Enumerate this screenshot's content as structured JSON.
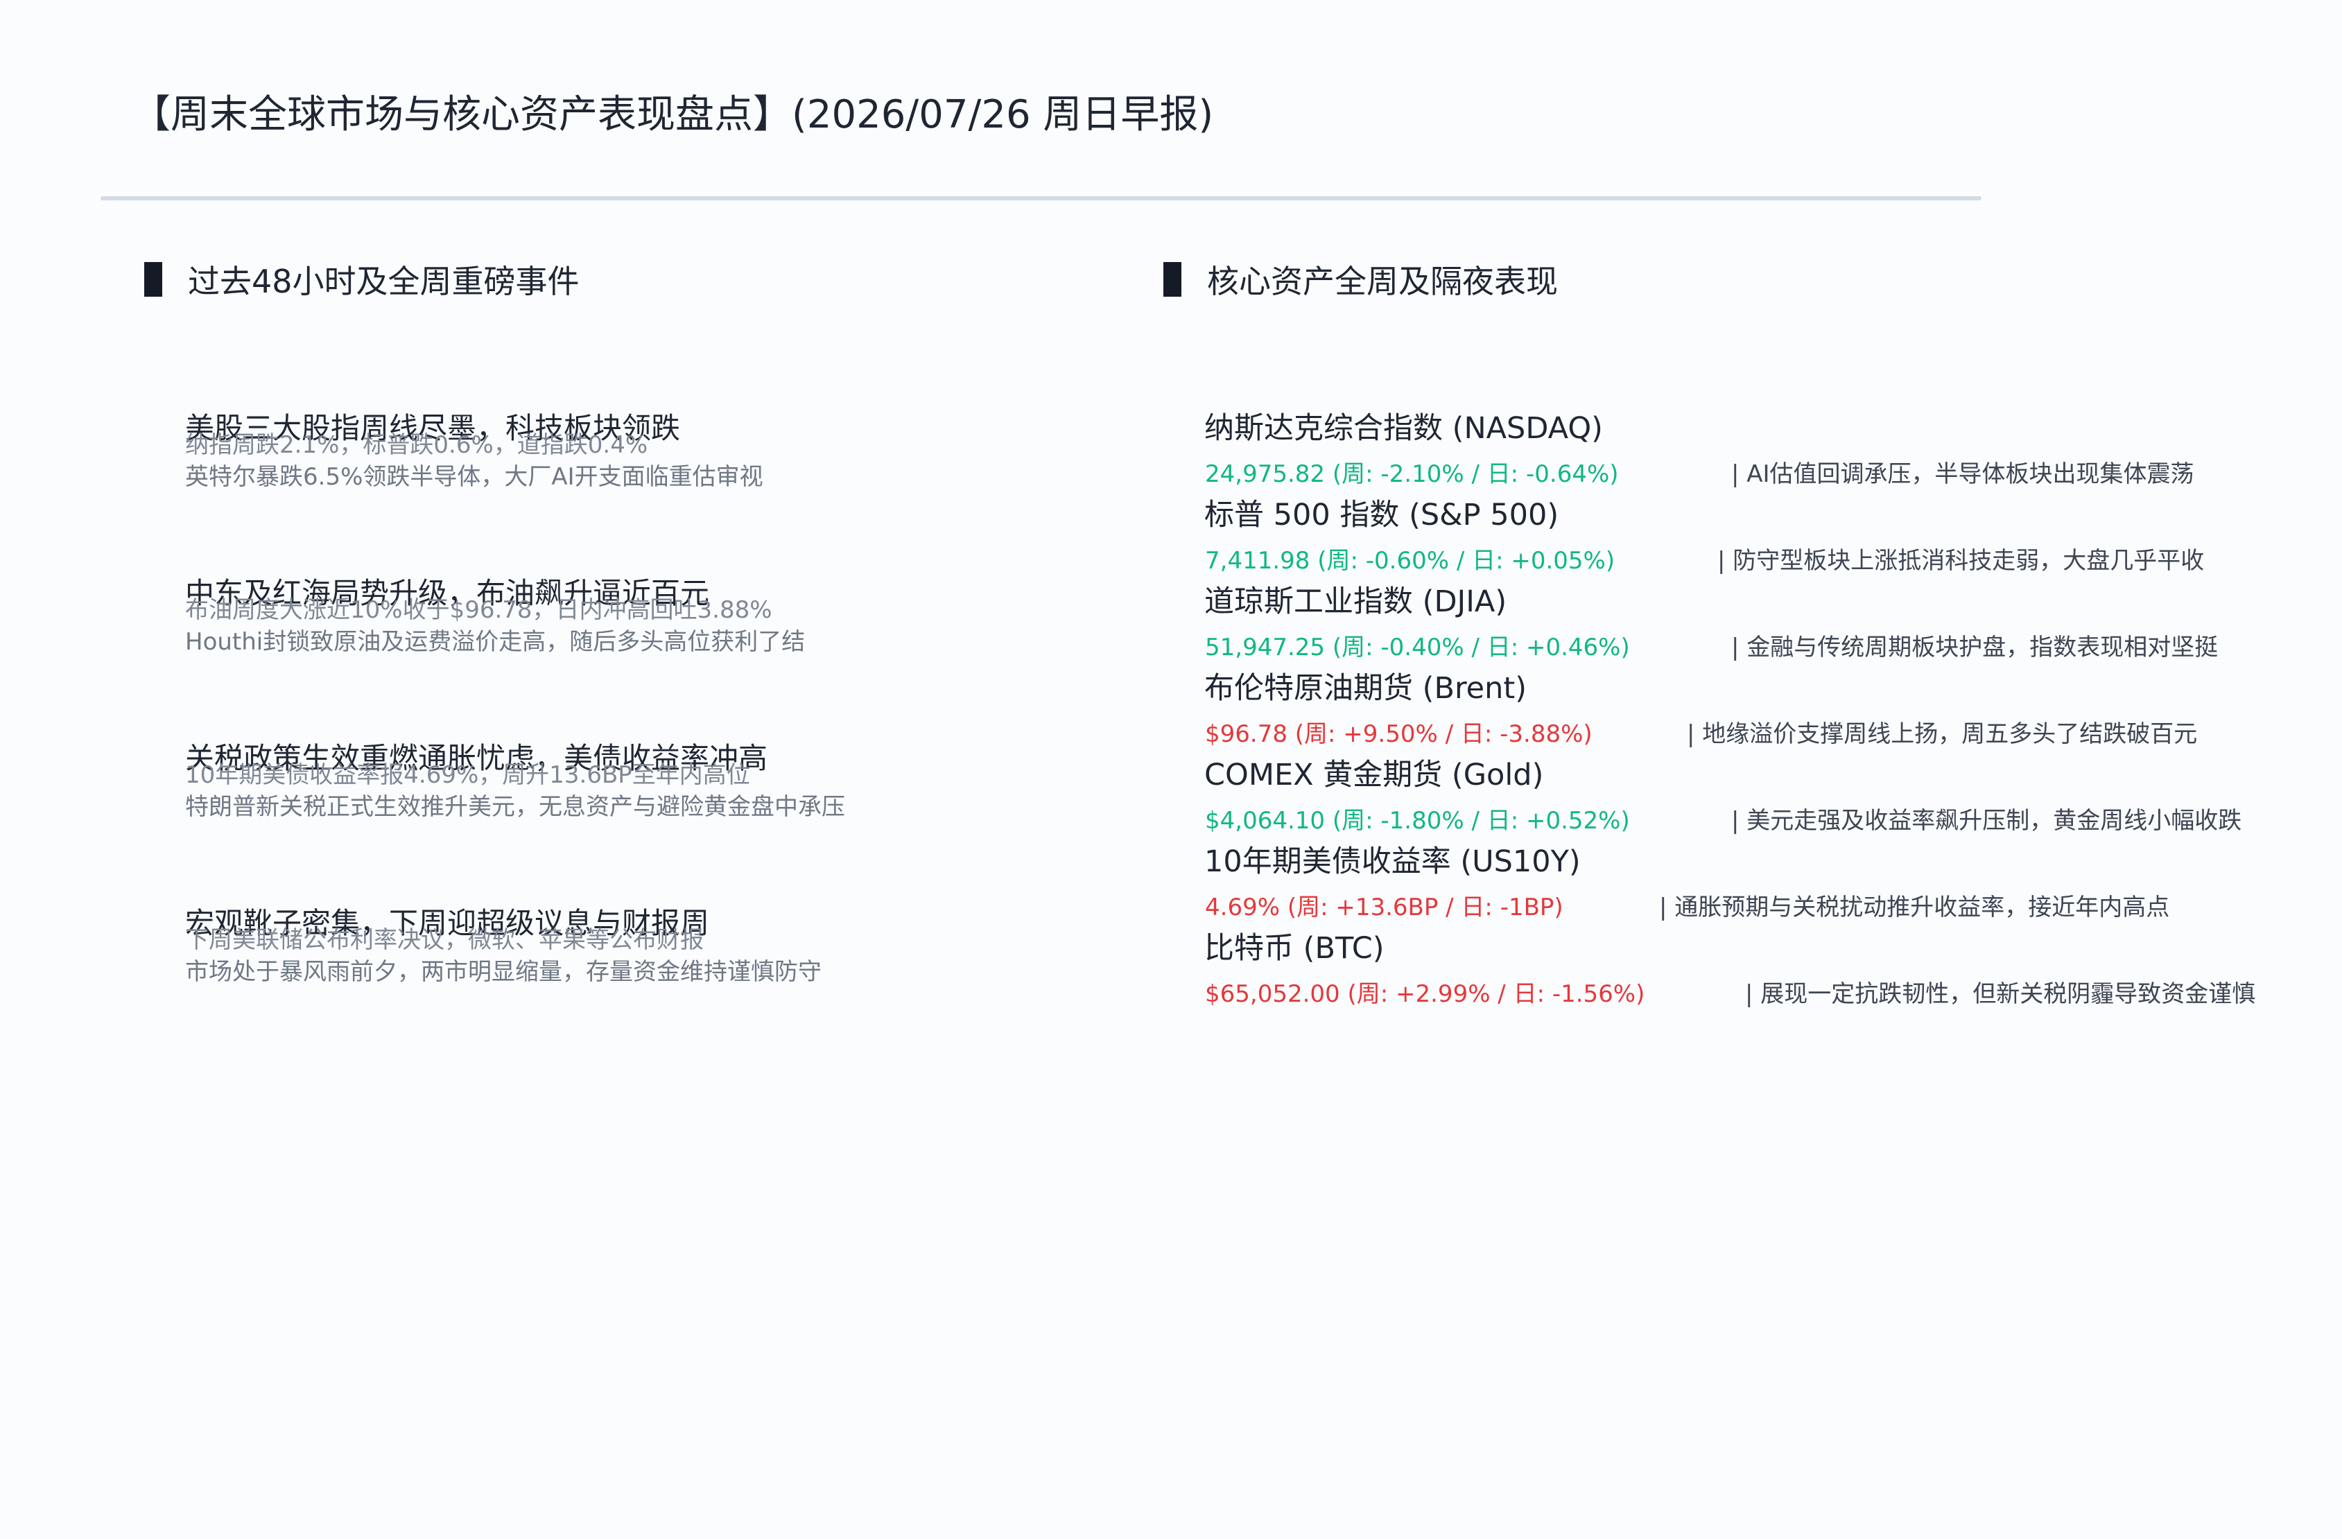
{
  "header": {
    "title": "【周末全球市场与核心资产表现盘点】(2026/07/26 周日早报)"
  },
  "sections": {
    "events_heading": "过去48小时及全周重磅事件",
    "assets_heading": "核心资产全周及隔夜表现"
  },
  "events": [
    {
      "title": "美股三大股指周线尽墨，科技板块领跌",
      "line1": "纳指周跌2.1%，标普跌0.6%，道指跌0.4%",
      "line2": "英特尔暴跌6.5%领跌半导体，大厂AI开支面临重估审视"
    },
    {
      "title": "中东及红海局势升级，布油飙升逼近百元",
      "line1": "布油周度大涨近10%收于$96.78，日内冲高回吐3.88%",
      "line2": "Houthi封锁致原油及运费溢价走高，随后多头高位获利了结"
    },
    {
      "title": "关税政策生效重燃通胀忧虑，美债收益率冲高",
      "line1": "10年期美债收益率报4.69%，周升13.6BP至年内高位",
      "line2": "特朗普新关税正式生效推升美元，无息资产与避险黄金盘中承压"
    },
    {
      "title": "宏观靴子密集，下周迎超级议息与财报周",
      "line1": "下周美联储公布利率决议，微软、苹果等公布财报",
      "line2": "市场处于暴风雨前夕，两市明显缩量，存量资金维持谨慎防守"
    }
  ],
  "assets": [
    {
      "name": "纳斯达克综合指数 (NASDAQ)",
      "value": "24,975.82 (周: -2.10% / 日: -0.64%)",
      "note": "|  AI估值回调承压，半导体板块出现集体震荡",
      "color": "#10b881"
    },
    {
      "name": "标普 500 指数 (S&P 500)",
      "value": "7,411.98 (周: -0.60% / 日: +0.05%)",
      "note": "|  防守型板块上涨抵消科技走弱，大盘几乎平收",
      "color": "#10b881"
    },
    {
      "name": "道琼斯工业指数 (DJIA)",
      "value": "51,947.25 (周: -0.40% / 日: +0.46%)",
      "note": "|  金融与传统周期板块护盘，指数表现相对坚挺",
      "color": "#10b881"
    },
    {
      "name": "布伦特原油期货 (Brent)",
      "value": "$96.78 (周: +9.50% / 日: -3.88%)",
      "note": "|  地缘溢价支撑周线上扬，周五多头了结跌破百元",
      "color": "#e5383b"
    },
    {
      "name": "COMEX 黄金期货 (Gold)",
      "value": "$4,064.10 (周: -1.80% / 日: +0.52%)",
      "note": "|  美元走强及收益率飙升压制，黄金周线小幅收跌",
      "color": "#10b881"
    },
    {
      "name": "10年期美债收益率 (US10Y)",
      "value": "4.69% (周: +13.6BP / 日: -1BP)",
      "note": "|  通胀预期与关税扰动推升收益率，接近年内高点",
      "color": "#e5383b"
    },
    {
      "name": "比特币 (BTC)",
      "value": "$65,052.00 (周: +2.99% / 日: -1.56%)",
      "note": "|  展现一定抗跌韧性，但新关税阴霾导致资金谨慎",
      "color": "#e5383b"
    }
  ]
}
